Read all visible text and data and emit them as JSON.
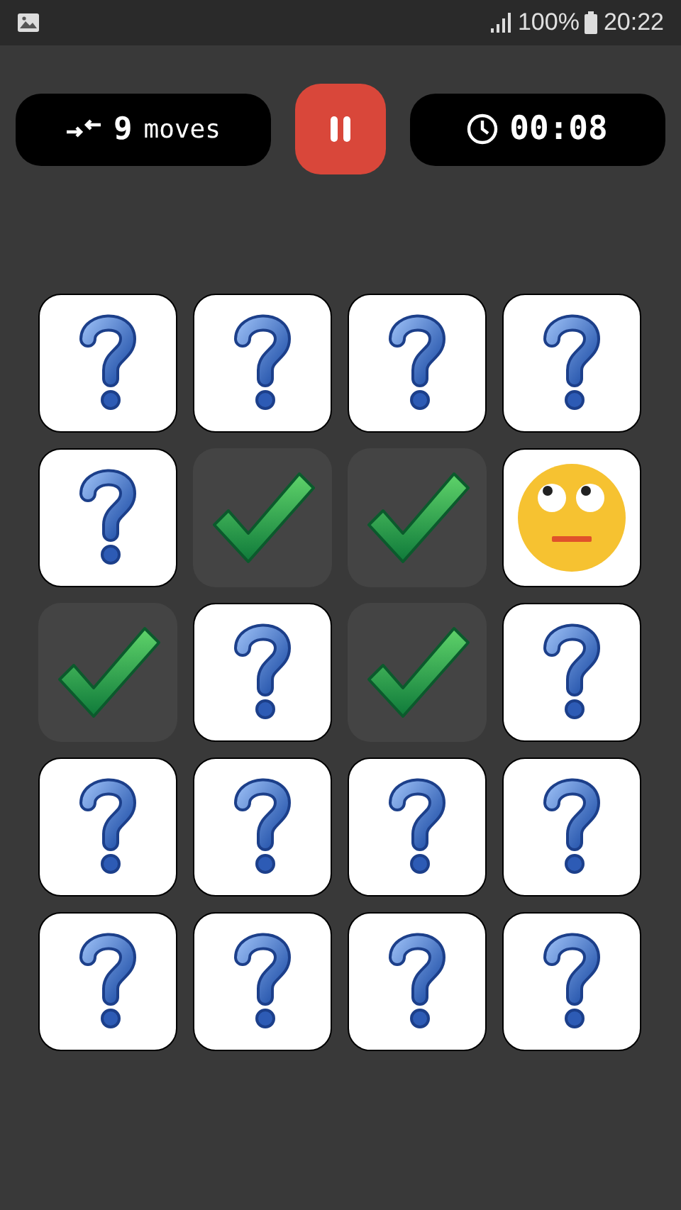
{
  "status_bar": {
    "battery": "100%",
    "time": "20:22"
  },
  "moves": {
    "count": "9",
    "label": "moves"
  },
  "timer": "00:08",
  "cards": [
    {
      "kind": "hidden"
    },
    {
      "kind": "hidden"
    },
    {
      "kind": "hidden"
    },
    {
      "kind": "hidden"
    },
    {
      "kind": "hidden"
    },
    {
      "kind": "matched"
    },
    {
      "kind": "matched"
    },
    {
      "kind": "revealed"
    },
    {
      "kind": "matched"
    },
    {
      "kind": "hidden"
    },
    {
      "kind": "matched"
    },
    {
      "kind": "hidden"
    },
    {
      "kind": "hidden"
    },
    {
      "kind": "hidden"
    },
    {
      "kind": "hidden"
    },
    {
      "kind": "hidden"
    },
    {
      "kind": "hidden"
    },
    {
      "kind": "hidden"
    },
    {
      "kind": "hidden"
    },
    {
      "kind": "hidden"
    }
  ]
}
